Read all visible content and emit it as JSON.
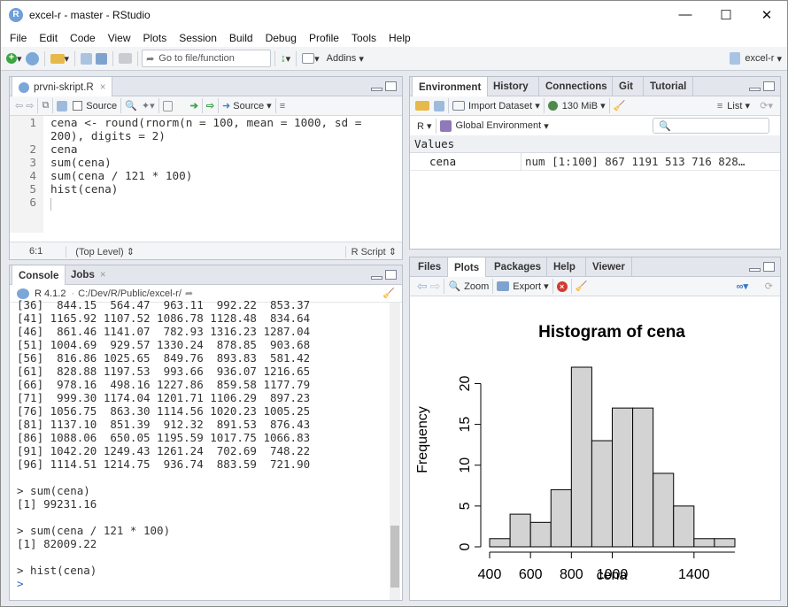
{
  "window": {
    "title": "excel-r - master - RStudio",
    "app_icon": "R"
  },
  "menu": [
    "File",
    "Edit",
    "Code",
    "View",
    "Plots",
    "Session",
    "Build",
    "Debug",
    "Profile",
    "Tools",
    "Help"
  ],
  "toolbar": {
    "goto_placeholder": "Go to file/function",
    "addins": "Addins",
    "project": "excel-r"
  },
  "editor": {
    "tab": "prvni-skript.R",
    "source_on_save": "Source",
    "source_button": "Source",
    "lines": [
      [
        "1",
        "cena <- round(rnorm(n = 100, mean = 1000, sd ="
      ],
      [
        "",
        "200), digits = 2)"
      ],
      [
        "2",
        "cena"
      ],
      [
        "3",
        "sum(cena)"
      ],
      [
        "4",
        "sum(cena / 121 * 100)"
      ],
      [
        "5",
        "hist(cena)"
      ],
      [
        "6",
        ""
      ]
    ],
    "status_pos": "6:1",
    "status_scope": "(Top Level)",
    "status_lang": "R Script"
  },
  "console": {
    "tabs": [
      "Console",
      "Jobs"
    ],
    "r_version": "R 4.1.2",
    "path": "C:/Dev/R/Public/excel-r/",
    "lines": [
      "[36]  844.15  564.47  963.11  992.22  853.37",
      "[41] 1165.92 1107.52 1086.78 1128.48  834.64",
      "[46]  861.46 1141.07  782.93 1316.23 1287.04",
      "[51] 1004.69  929.57 1330.24  878.85  903.68",
      "[56]  816.86 1025.65  849.76  893.83  581.42",
      "[61]  828.88 1197.53  993.66  936.07 1216.65",
      "[66]  978.16  498.16 1227.86  859.58 1177.79",
      "[71]  999.30 1174.04 1201.71 1106.29  897.23",
      "[76] 1056.75  863.30 1114.56 1020.23 1005.25",
      "[81] 1137.10  851.39  912.32  891.53  876.43",
      "[86] 1088.06  650.05 1195.59 1017.75 1066.83",
      "[91] 1042.20 1249.43 1261.24  702.69  748.22",
      "[96] 1114.51 1214.75  936.74  883.59  721.90",
      "",
      "> sum(cena)",
      "[1] 99231.16",
      "",
      "> sum(cena / 121 * 100)",
      "[1] 82009.22",
      "",
      "> hist(cena)",
      "> "
    ]
  },
  "environment": {
    "tabs": [
      "Environment",
      "History",
      "Connections",
      "Git",
      "Tutorial"
    ],
    "import_dataset": "Import Dataset",
    "memory": "130 MiB",
    "view_mode": "List",
    "language": "R",
    "scope": "Global Environment",
    "section": "Values",
    "values": [
      {
        "name": "cena",
        "value": "num [1:100] 867 1191 513 716 828…"
      }
    ]
  },
  "files": {
    "tabs": [
      "Files",
      "Plots",
      "Packages",
      "Help",
      "Viewer"
    ],
    "zoom": "Zoom",
    "export": "Export"
  },
  "chart_data": {
    "type": "bar",
    "title": "Histogram of cena",
    "xlabel": "cena",
    "ylabel": "Frequency",
    "bin_edges": [
      400,
      500,
      600,
      700,
      800,
      900,
      1000,
      1100,
      1200,
      1300,
      1400,
      1500,
      1600
    ],
    "values": [
      1,
      4,
      3,
      7,
      22,
      13,
      17,
      17,
      9,
      5,
      1,
      1
    ],
    "xticks": [
      400,
      600,
      800,
      1000,
      1400
    ],
    "yticks": [
      0,
      5,
      10,
      15,
      20
    ],
    "xlim": [
      400,
      1600
    ],
    "ylim": [
      0,
      22
    ],
    "bar_color": "#d3d3d3"
  }
}
